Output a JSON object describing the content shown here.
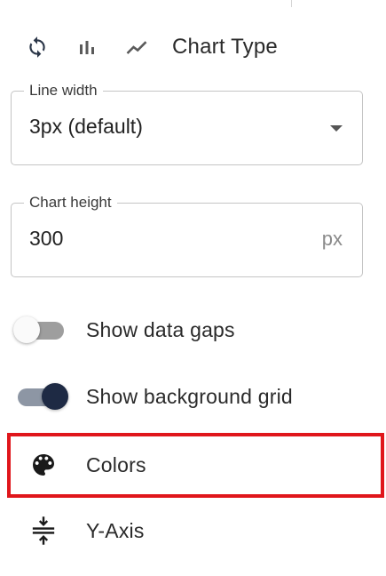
{
  "chart_type": {
    "label": "Chart Type",
    "icons": [
      "refresh-icon",
      "bar-chart-icon",
      "line-chart-icon"
    ]
  },
  "line_width": {
    "label": "Line width",
    "value": "3px (default)"
  },
  "chart_height": {
    "label": "Chart height",
    "value": "300",
    "unit": "px"
  },
  "toggles": [
    {
      "label": "Show data gaps",
      "checked": false
    },
    {
      "label": "Show background grid",
      "checked": true
    }
  ],
  "menu": [
    {
      "label": "Colors",
      "icon": "palette-icon",
      "highlighted": true
    },
    {
      "label": "Y-Axis",
      "icon": "y-axis-height-icon",
      "highlighted": false
    }
  ],
  "colors": {
    "highlight": "#e0161b",
    "toggle_on_thumb": "#1e2a44",
    "toggle_on_track": "#8d96a4"
  }
}
